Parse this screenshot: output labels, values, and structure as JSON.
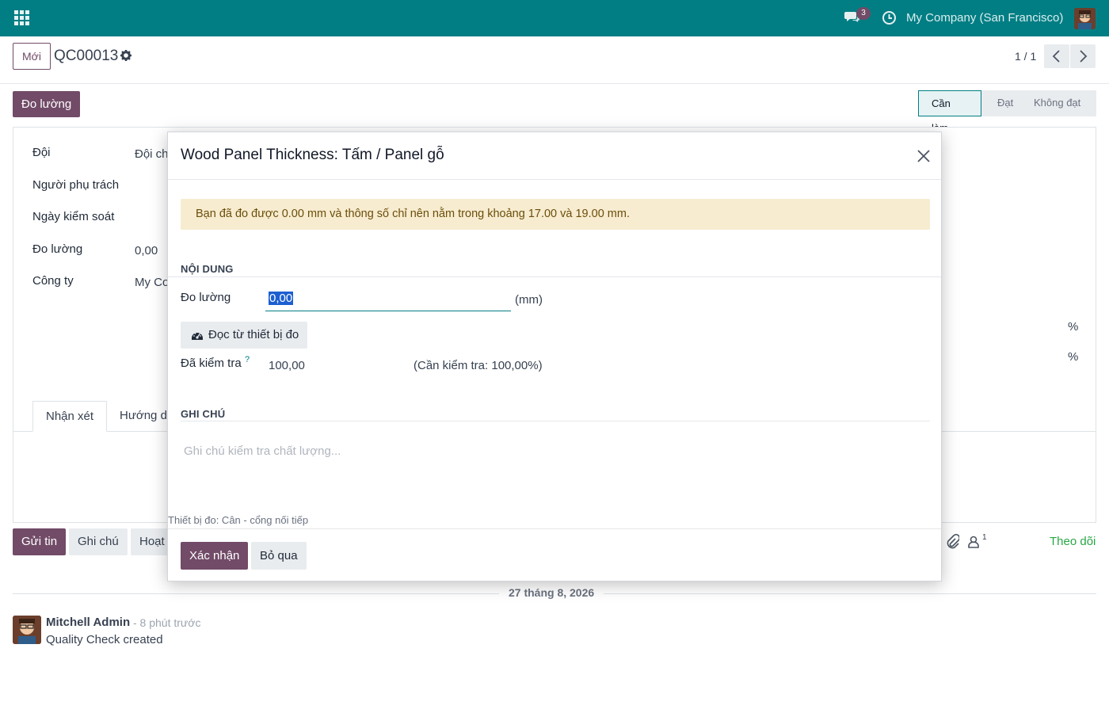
{
  "navbar": {
    "messages_count": "3",
    "company": "My Company (San Francisco)",
    "bg_color": "#017e84"
  },
  "control_panel": {
    "new_button": "Mới",
    "record_name": "QC00013",
    "pager": "1 / 1"
  },
  "header": {
    "measure_button": "Đo lường",
    "stages": [
      "Cần làm",
      "Đạt",
      "Không đạt"
    ],
    "active_stage": "Cần làm"
  },
  "form": {
    "labels": {
      "team": "Đội",
      "responsible": "Người phụ trách",
      "control_date": "Ngày kiểm soát",
      "measure": "Đo lường",
      "company": "Công ty"
    },
    "values": {
      "team": "Đội ch",
      "measure": "0,00",
      "company": "My Co"
    },
    "percent_symbol": "%",
    "tabs": [
      "Nhận xét",
      "Hướng d"
    ]
  },
  "chatter": {
    "send_button": "Gửi tin",
    "note_button": "Ghi chú",
    "activity_button": "Hoạt",
    "followers_count": "1",
    "follow_link": "Theo dõi",
    "date_separator": "27 tháng 8, 2026",
    "message": {
      "author": "Mitchell Admin",
      "time": "- 8 phút trước",
      "body": "Quality Check created"
    }
  },
  "modal": {
    "title": "Wood Panel Thickness: Tấm / Panel gỗ",
    "alert": "Bạn đã đo được 0.00 mm và thông số chỉ nên nằm trong khoảng 17.00 và 19.00 mm.",
    "section_content": "NỘI DUNG",
    "measure_label": "Đo lường",
    "measure_value": "0,00",
    "unit": "(mm)",
    "read_device_button": "Đọc từ thiết bị đo",
    "checked_label": "Đã kiểm tra",
    "tooltip_mark": "?",
    "checked_value": "100,00",
    "required_text": "(Cần kiểm tra: 100,00%)",
    "section_notes": "GHI CHÚ",
    "notes_placeholder": "Ghi chú kiểm tra chất lượng...",
    "device_text": "Thiết bị đo: Cân - cổng nối tiếp",
    "confirm_button": "Xác nhận",
    "discard_button": "Bỏ qua"
  },
  "colors": {
    "primary": "#714b67",
    "accent": "#017e84",
    "alert_bg": "#f7ecd0"
  }
}
